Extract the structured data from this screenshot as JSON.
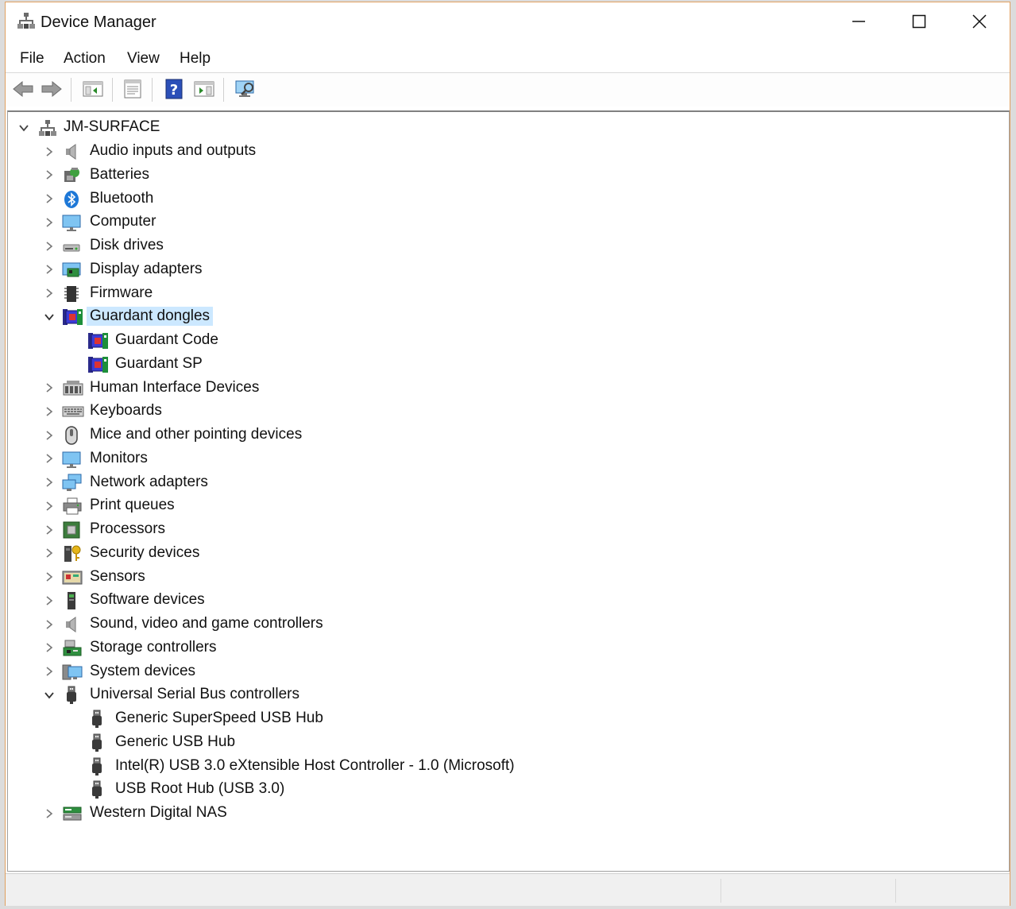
{
  "window": {
    "title": "Device Manager"
  },
  "menubar": {
    "items": [
      "File",
      "Action",
      "View",
      "Help"
    ]
  },
  "toolbar": {
    "buttons": [
      {
        "name": "back-icon"
      },
      {
        "name": "forward-icon"
      },
      {
        "name": "show-hide-console-tree-icon"
      },
      {
        "name": "properties-icon"
      },
      {
        "name": "help-icon"
      },
      {
        "name": "show-action-pane-icon"
      },
      {
        "name": "scan-hardware-changes-icon"
      }
    ]
  },
  "tree": {
    "root": "JM-SURFACE",
    "nodes": [
      {
        "label": "Audio inputs and outputs",
        "icon": "speaker-icon",
        "level": 1,
        "expander": "collapsed"
      },
      {
        "label": "Batteries",
        "icon": "battery-icon",
        "level": 1,
        "expander": "collapsed"
      },
      {
        "label": "Bluetooth",
        "icon": "bluetooth-icon",
        "level": 1,
        "expander": "collapsed"
      },
      {
        "label": "Computer",
        "icon": "computer-icon",
        "level": 1,
        "expander": "collapsed"
      },
      {
        "label": "Disk drives",
        "icon": "disk-drive-icon",
        "level": 1,
        "expander": "collapsed"
      },
      {
        "label": "Display adapters",
        "icon": "display-adapter-icon",
        "level": 1,
        "expander": "collapsed"
      },
      {
        "label": "Firmware",
        "icon": "firmware-icon",
        "level": 1,
        "expander": "collapsed"
      },
      {
        "label": "Guardant dongles",
        "icon": "dongle-icon",
        "level": 1,
        "expander": "expanded",
        "selected": true
      },
      {
        "label": "Guardant Code",
        "icon": "dongle-icon",
        "level": 2,
        "expander": "none"
      },
      {
        "label": "Guardant SP",
        "icon": "dongle-icon",
        "level": 2,
        "expander": "none"
      },
      {
        "label": "Human Interface Devices",
        "icon": "hid-icon",
        "level": 1,
        "expander": "collapsed"
      },
      {
        "label": "Keyboards",
        "icon": "keyboard-icon",
        "level": 1,
        "expander": "collapsed"
      },
      {
        "label": "Mice and other pointing devices",
        "icon": "mouse-icon",
        "level": 1,
        "expander": "collapsed"
      },
      {
        "label": "Monitors",
        "icon": "monitor-icon",
        "level": 1,
        "expander": "collapsed"
      },
      {
        "label": "Network adapters",
        "icon": "network-adapter-icon",
        "level": 1,
        "expander": "collapsed"
      },
      {
        "label": "Print queues",
        "icon": "printer-icon",
        "level": 1,
        "expander": "collapsed"
      },
      {
        "label": "Processors",
        "icon": "processor-icon",
        "level": 1,
        "expander": "collapsed"
      },
      {
        "label": "Security devices",
        "icon": "security-device-icon",
        "level": 1,
        "expander": "collapsed"
      },
      {
        "label": "Sensors",
        "icon": "sensor-icon",
        "level": 1,
        "expander": "collapsed"
      },
      {
        "label": "Software devices",
        "icon": "software-device-icon",
        "level": 1,
        "expander": "collapsed"
      },
      {
        "label": "Sound, video and game controllers",
        "icon": "speaker-icon",
        "level": 1,
        "expander": "collapsed"
      },
      {
        "label": "Storage controllers",
        "icon": "storage-controller-icon",
        "level": 1,
        "expander": "collapsed"
      },
      {
        "label": "System devices",
        "icon": "system-device-icon",
        "level": 1,
        "expander": "collapsed"
      },
      {
        "label": "Universal Serial Bus controllers",
        "icon": "usb-icon",
        "level": 1,
        "expander": "expanded"
      },
      {
        "label": "Generic SuperSpeed USB Hub",
        "icon": "usb-icon",
        "level": 2,
        "expander": "none"
      },
      {
        "label": "Generic USB Hub",
        "icon": "usb-icon",
        "level": 2,
        "expander": "none"
      },
      {
        "label": "Intel(R) USB 3.0 eXtensible Host Controller - 1.0 (Microsoft)",
        "icon": "usb-icon",
        "level": 2,
        "expander": "none"
      },
      {
        "label": "USB Root Hub (USB 3.0)",
        "icon": "usb-icon",
        "level": 2,
        "expander": "none"
      },
      {
        "label": "Western Digital NAS",
        "icon": "nas-icon",
        "level": 1,
        "expander": "collapsed"
      }
    ]
  },
  "colors": {
    "selection": "#cce8ff",
    "window_border": "#e0a060",
    "accent_blue": "#1e78d7"
  }
}
